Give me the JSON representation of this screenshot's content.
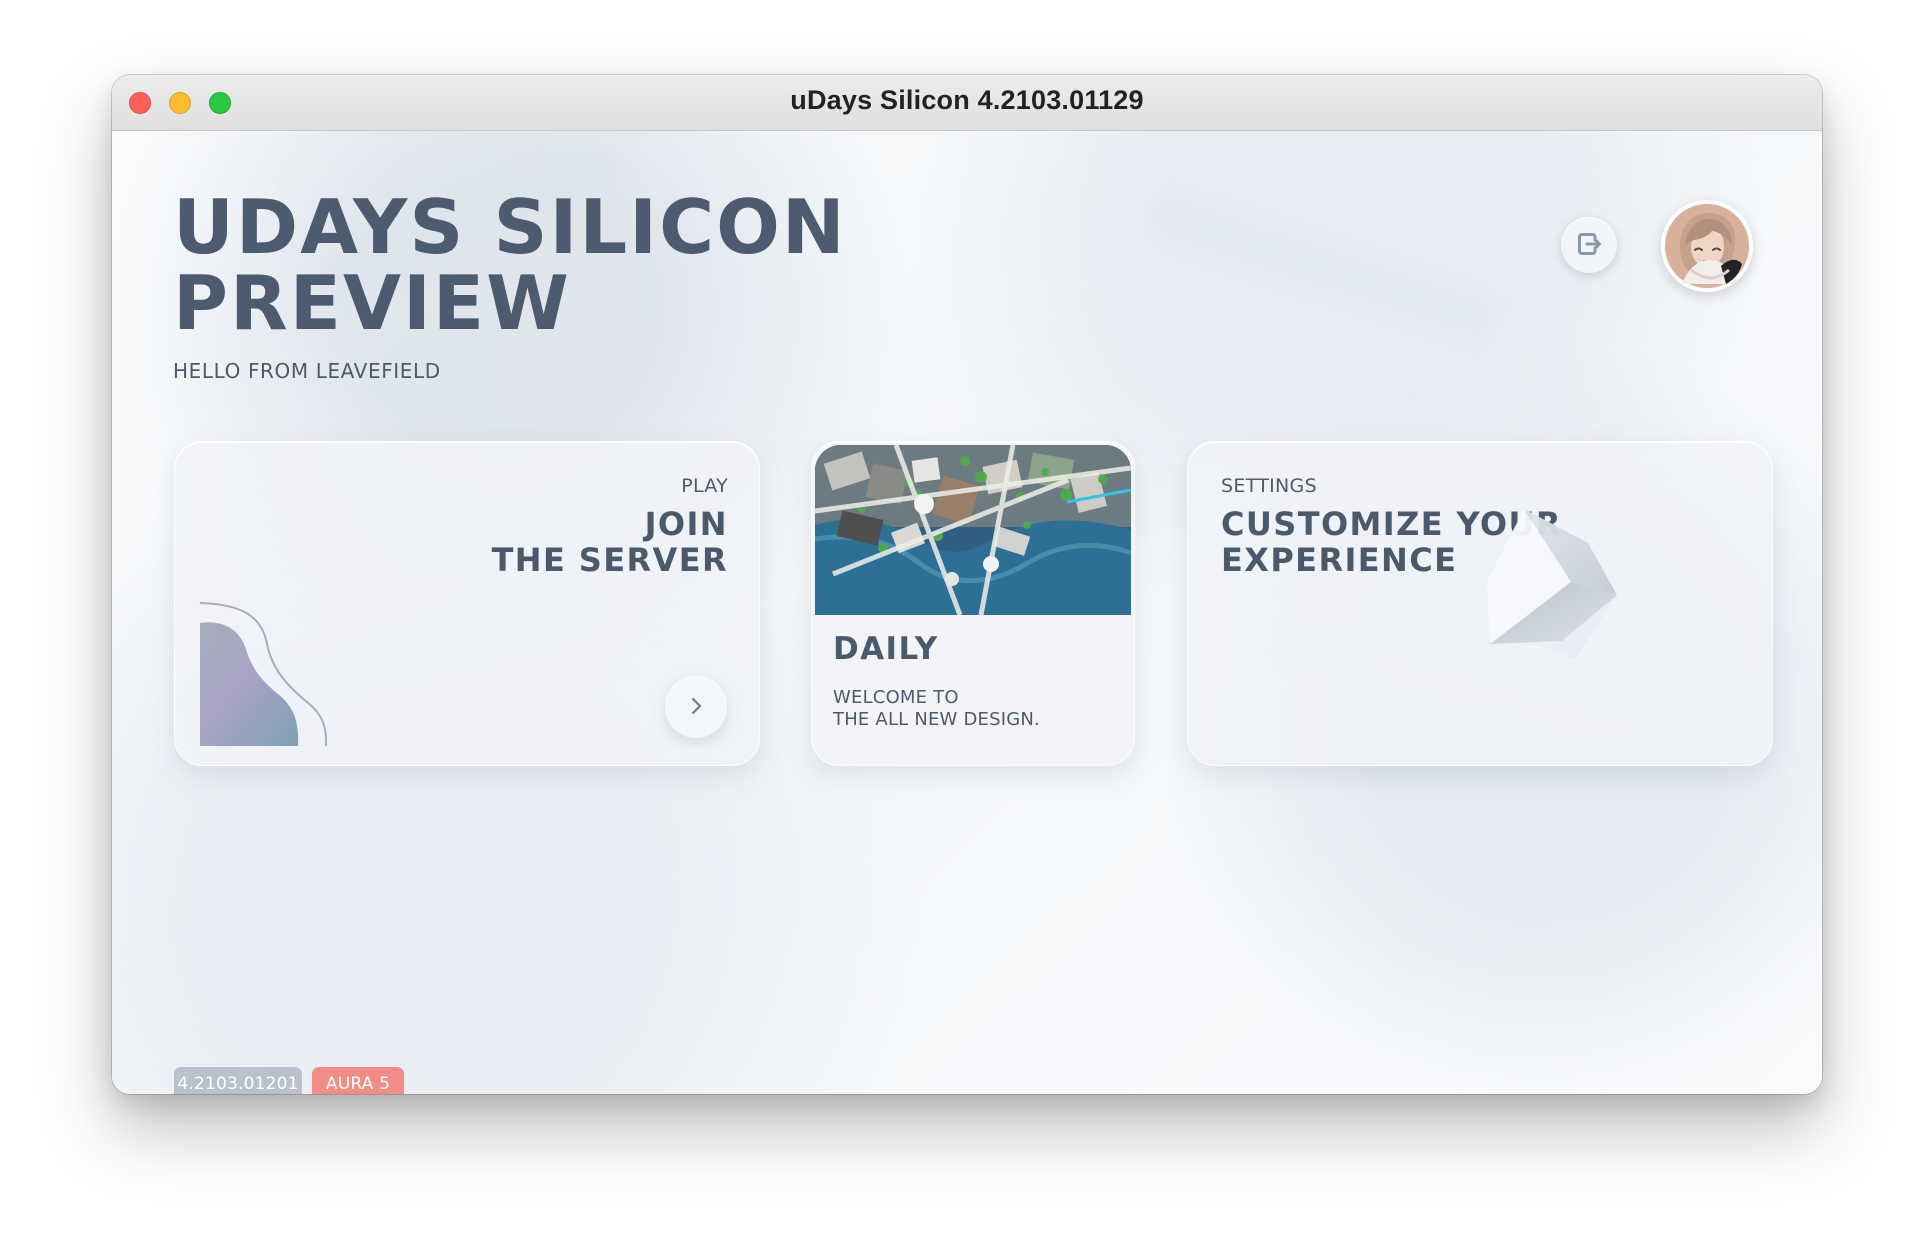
{
  "window": {
    "title": "uDays Silicon 4.2103.01129"
  },
  "header": {
    "title_line_1": "UDAYS SILICON",
    "title_line_2": "PREVIEW",
    "subtitle": "HELLO FROM LEAVEFIELD"
  },
  "top_actions": {
    "logout_icon": "logout-icon",
    "avatar_icon": "profile-avatar"
  },
  "cards": {
    "play": {
      "eyebrow": "PLAY",
      "title_line_1": "JOIN",
      "title_line_2": "THE SERVER",
      "action_icon": "chevron-right-icon"
    },
    "daily": {
      "title": "DAILY",
      "body_line_1": "WELCOME TO",
      "body_line_2": "THE ALL NEW DESIGN."
    },
    "settings": {
      "eyebrow": "SETTINGS",
      "title_line_1": "CUSTOMIZE YOUR",
      "title_line_2": "EXPERIENCE"
    }
  },
  "badges": {
    "version": "4.2103.01201",
    "aura": "AURA 5"
  },
  "colors": {
    "text_primary": "#4c5b6f",
    "badge_version": "#b8c1cd",
    "badge_aura": "#f28c86",
    "window_red": "#fe5f57",
    "window_yellow": "#febc2e",
    "window_green": "#28c840"
  }
}
